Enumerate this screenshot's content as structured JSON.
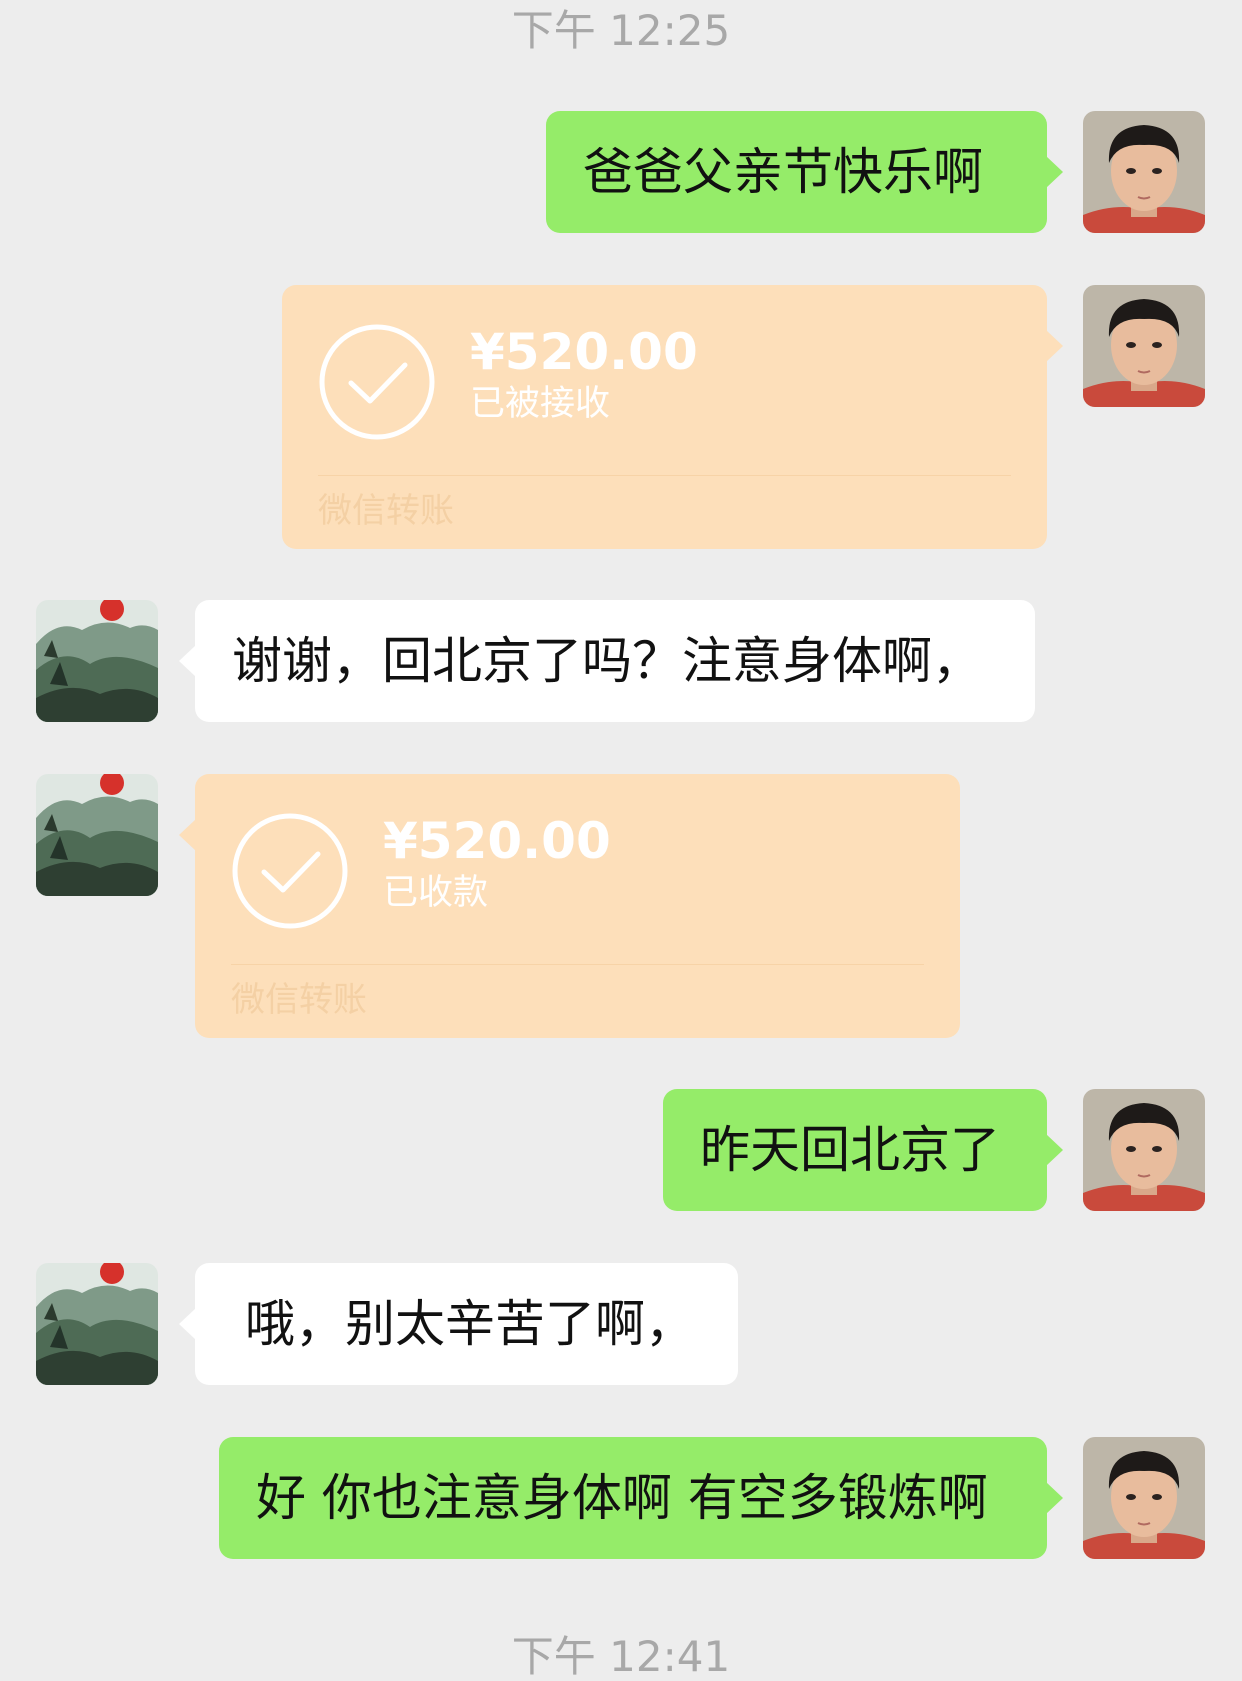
{
  "timestamps": {
    "top": "下午 12:25",
    "bottom": "下午 12:41"
  },
  "messages": [
    {
      "sender": "me",
      "type": "text",
      "text": "爸爸父亲节快乐啊"
    },
    {
      "sender": "me",
      "type": "transfer",
      "amount": "¥520.00",
      "status": "已被接收",
      "footer": "微信转账"
    },
    {
      "sender": "other",
      "type": "text",
      "text": "谢谢，回北京了吗？注意身体啊，"
    },
    {
      "sender": "other",
      "type": "transfer",
      "amount": "¥520.00",
      "status": "已收款",
      "footer": "微信转账"
    },
    {
      "sender": "me",
      "type": "text",
      "text": "昨天回北京了"
    },
    {
      "sender": "other",
      "type": "text",
      "text": "哦，别太辛苦了啊，"
    },
    {
      "sender": "me",
      "type": "text",
      "text": "好 你也注意身体啊 有空多锻炼啊"
    }
  ],
  "colors": {
    "background": "#ededed",
    "my_bubble": "#95ec69",
    "other_bubble": "#ffffff",
    "transfer_card": "#fddfba"
  },
  "icons": {
    "self_avatar": "boy-portrait-avatar",
    "other_avatar": "landscape-painting-avatar",
    "transfer_status": "check-circle-icon"
  }
}
